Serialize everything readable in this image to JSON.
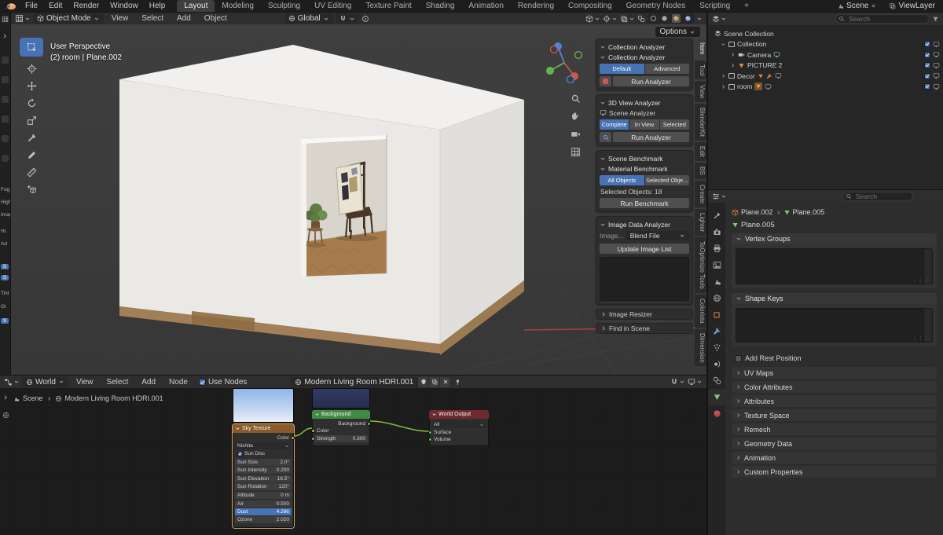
{
  "topbar": {
    "menus": [
      "File",
      "Edit",
      "Render",
      "Window",
      "Help"
    ],
    "workspaces": [
      "Layout",
      "Modeling",
      "Sculpting",
      "UV Editing",
      "Texture Paint",
      "Shading",
      "Animation",
      "Rendering",
      "Compositing",
      "Geometry Nodes",
      "Scripting"
    ],
    "add_tab": "+",
    "scene_label": "Scene",
    "viewlayer_label": "ViewLayer"
  },
  "viewport": {
    "header": {
      "mode": "Object Mode",
      "menus": [
        "View",
        "Select",
        "Add",
        "Object"
      ],
      "orientation": "Global",
      "options_label": "Options"
    },
    "overlay": {
      "line1": "User Perspective",
      "line2": "(2) room | Plane.002"
    }
  },
  "left_strip": {
    "fragments": [
      {
        "t": "Fog"
      },
      {
        "t": "High"
      },
      {
        "t": "Imag"
      },
      {
        "t": "Hi"
      },
      {
        "t": "Ad"
      },
      {
        "t": "S"
      },
      {
        "t": "S"
      },
      {
        "t": "Tint"
      },
      {
        "t": "Gl"
      },
      {
        "t": "S"
      }
    ]
  },
  "analyzer": {
    "panel_title": "Collection Analyzer",
    "collection": {
      "title": "Collection Analyzer",
      "modes": [
        "Default",
        "Advanced"
      ],
      "run": "Run Analyzer"
    },
    "view3d": {
      "title": "3D View Analyzer",
      "scene_analyzer": "Scene Analyzer",
      "scopes": [
        "Complete",
        "In View",
        "Selected"
      ],
      "run": "Run Analyzer"
    },
    "benchmark": {
      "title": "Scene Benchmark",
      "subtitle": "Material Benchmark",
      "targets": [
        "All Objects",
        "Selected Obje..."
      ],
      "selected_info": "Selected Objects: 18",
      "run": "Run Benchmark"
    },
    "image": {
      "title": "Image Data Analyzer",
      "source_label": "Image...",
      "source_value": "Blend File",
      "update": "Update Image List"
    },
    "collapsed": [
      "Image Resizer",
      "Find in Scene"
    ]
  },
  "side_tabs": [
    "Item",
    "Tool",
    "View",
    "BlenderKit",
    "Edit",
    "BS",
    "Create",
    "Lighter",
    "ToOptimize Tools",
    "Colorista",
    "Dimension"
  ],
  "outliner": {
    "search_placeholder": "Search",
    "rows": [
      {
        "label": "Scene Collection"
      },
      {
        "label": "Collection"
      },
      {
        "label": "Camera"
      },
      {
        "label": "PICTURE 2"
      },
      {
        "label": "Decor"
      },
      {
        "label": "room"
      }
    ]
  },
  "properties": {
    "search_placeholder": "Search",
    "breadcrumb": {
      "object": "Plane.002",
      "data": "Plane.005"
    },
    "data_name": "Plane.005",
    "vertex_groups_title": "Vertex Groups",
    "shape_keys_title": "Shape Keys",
    "add_rest_position": "Add Rest Position",
    "collapsed_panels": [
      "UV Maps",
      "Color Attributes",
      "Attributes",
      "Texture Space",
      "Remesh",
      "Geometry Data",
      "Animation",
      "Custom Properties"
    ]
  },
  "shader": {
    "header": {
      "world_selector": "World",
      "menus": [
        "View",
        "Select",
        "Add",
        "Node"
      ],
      "use_nodes": "Use Nodes",
      "datablock": "Modern Living Room HDRI.001"
    },
    "path": {
      "scene": "Scene",
      "world": "Modern Living Room HDRI.001"
    },
    "sky_node": {
      "title": "Sky Texture",
      "output_label": "Color",
      "sky_type": "Nishita",
      "sun_disc": "Sun Disc",
      "fields": [
        {
          "label": "Sun Size",
          "value": "2.0°"
        },
        {
          "label": "Sun Intensity",
          "value": "0.200"
        },
        {
          "label": "Sun Elevation",
          "value": "16.5°"
        },
        {
          "label": "Sun Rotation",
          "value": "120°"
        },
        {
          "label": "Altitude",
          "value": "0 m"
        },
        {
          "label": "Air",
          "value": "0.500"
        },
        {
          "label": "Dust",
          "value": "4.286"
        },
        {
          "label": "Ozone",
          "value": "2.020"
        }
      ]
    },
    "background_node": {
      "title": "Background",
      "output_label": "Background",
      "color_label": "Color",
      "strength_label": "Strength",
      "strength_value": "0.300"
    },
    "output_node": {
      "title": "World Output",
      "target_value": "All",
      "surface_label": "Surface",
      "volume_label": "Volume"
    }
  },
  "colors": {
    "accent_blue": "#4772b3",
    "mesh_orange": "#e0883c",
    "data_green": "#7ccc6e",
    "noodle_green": "#88b83e"
  },
  "icons": {
    "search": "magnifier",
    "filter": "funnel",
    "snap": "magnet",
    "camera": "camera",
    "screen": "monitor",
    "mesh_data": "inverted-triangle",
    "world": "globe",
    "pin": "pushpin",
    "fake_user": "shield",
    "close": "x"
  }
}
